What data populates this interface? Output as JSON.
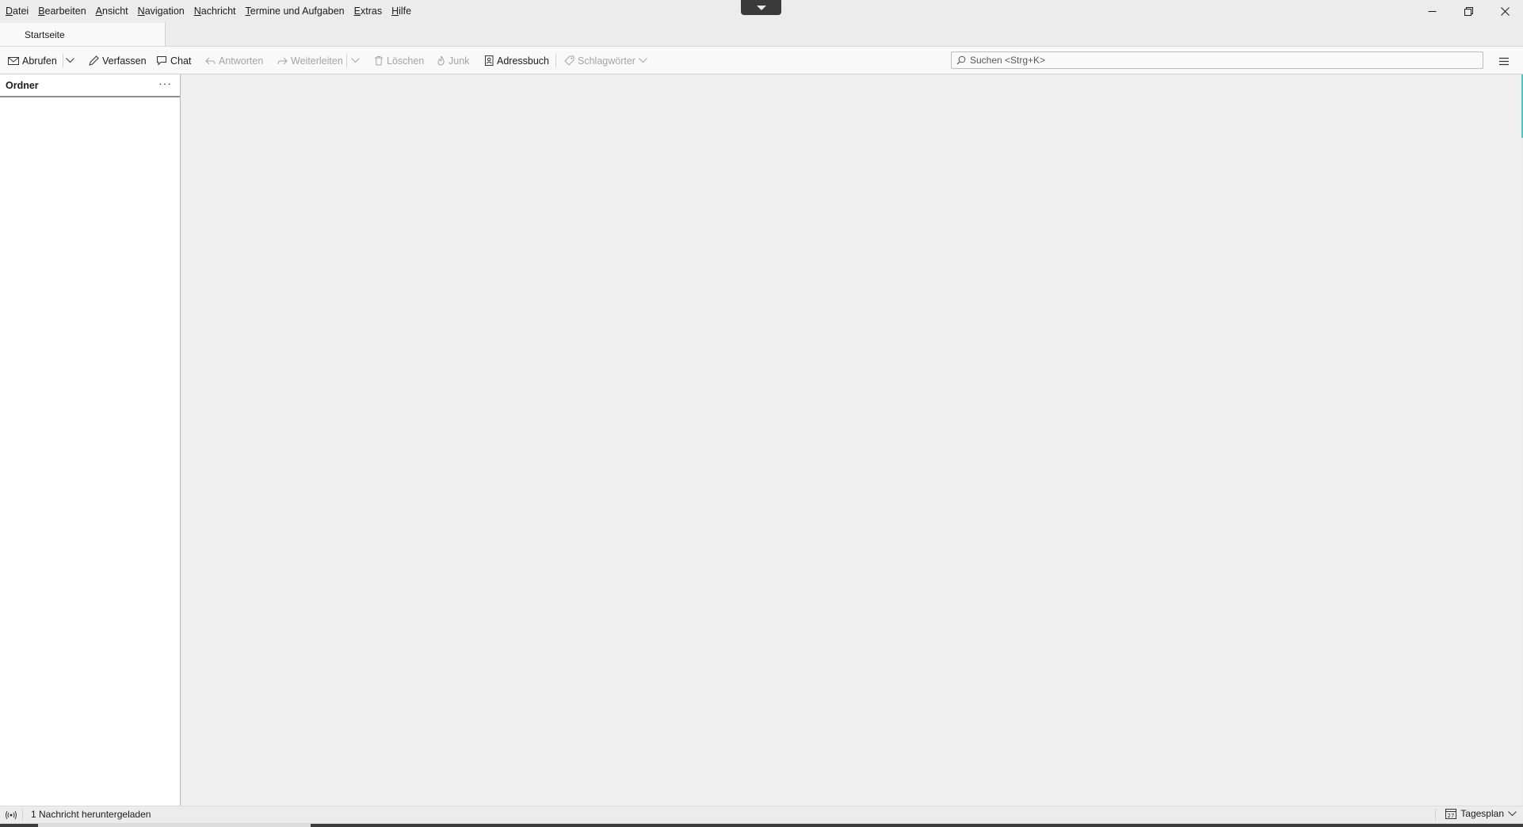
{
  "menubar": {
    "items": [
      "Datei",
      "Bearbeiten",
      "Ansicht",
      "Navigation",
      "Nachricht",
      "Termine und Aufgaben",
      "Extras",
      "Hilfe"
    ]
  },
  "tabs": {
    "home": "Startseite"
  },
  "toolbar": {
    "get_messages": "Abrufen",
    "write": "Verfassen",
    "chat": "Chat",
    "reply": "Antworten",
    "forward": "Weiterleiten",
    "delete": "Löschen",
    "junk": "Junk",
    "address_book": "Adressbuch",
    "tags": "Schlagwörter"
  },
  "search": {
    "placeholder": "Suchen <Strg+K>",
    "value": ""
  },
  "folder_pane": {
    "title": "Ordner",
    "more": "···"
  },
  "statusbar": {
    "text": "1 Nachricht heruntergeladen",
    "today_pane": "Tagesplan"
  },
  "icons": [
    "chevron-down-icon",
    "minimize-icon",
    "restore-icon",
    "close-icon",
    "envelope-icon",
    "pencil-icon",
    "chat-bubble-icon",
    "reply-icon",
    "forward-icon",
    "trash-icon",
    "junk-flame-icon",
    "address-book-icon",
    "tag-icon",
    "search-icon",
    "hamburger-menu-icon",
    "online-status-icon",
    "calendar-icon"
  ],
  "colors": {
    "background": "#ececec",
    "toolbar": "#f9f9f9",
    "main": "#efefef",
    "disabled_text": "#a4a4a4",
    "accent_edge": "#55c3c0"
  }
}
